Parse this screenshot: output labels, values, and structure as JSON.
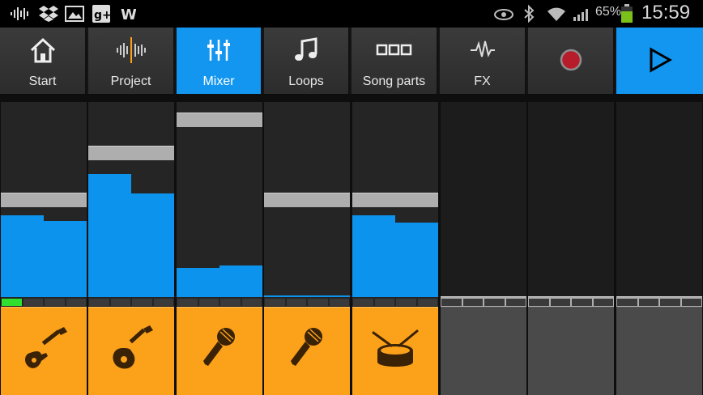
{
  "status_bar": {
    "icons": [
      "audio-wave-icon",
      "dropbox-icon",
      "gallery-icon",
      "google-plus-icon",
      "wordpress-icon",
      "eye-icon",
      "bluetooth-icon",
      "wifi-icon",
      "signal-icon",
      "battery-icon"
    ],
    "battery_percent": "65%",
    "time": "15:59"
  },
  "toolbar": {
    "tabs": [
      {
        "label": "Start",
        "icon": "home-icon",
        "active": false
      },
      {
        "label": "Project",
        "icon": "waveform-icon",
        "active": false
      },
      {
        "label": "Mixer",
        "icon": "sliders-icon",
        "active": true
      },
      {
        "label": "Loops",
        "icon": "music-note-icon",
        "active": false
      },
      {
        "label": "Song parts",
        "icon": "song-parts-icon",
        "active": false
      },
      {
        "label": "FX",
        "icon": "fx-wave-icon",
        "active": false
      }
    ],
    "record_icon": "record-icon",
    "play_icon": "play-icon",
    "colors": {
      "active": "#1296f0",
      "record": "#c62828",
      "accent": "#fca11a"
    }
  },
  "mixer": {
    "channels": [
      {
        "instrument": "electric-guitar-icon",
        "volume": 0.55,
        "meter_left": 0.42,
        "meter_right": 0.39,
        "active_step": 0,
        "empty": false
      },
      {
        "instrument": "acoustic-guitar-icon",
        "volume": 0.8,
        "meter_left": 0.63,
        "meter_right": 0.53,
        "empty": false
      },
      {
        "instrument": "microphone-icon",
        "volume": 0.98,
        "meter_left": 0.15,
        "meter_right": 0.16,
        "empty": false
      },
      {
        "instrument": "microphone-icon",
        "volume": 0.55,
        "meter_left": 0.005,
        "meter_right": 0.005,
        "empty": false
      },
      {
        "instrument": "drum-icon",
        "volume": 0.55,
        "meter_left": 0.42,
        "meter_right": 0.38,
        "empty": false
      },
      {
        "instrument": "",
        "volume": 0.0,
        "meter_left": 0,
        "meter_right": 0,
        "empty": true
      },
      {
        "instrument": "",
        "volume": 0.0,
        "meter_left": 0,
        "meter_right": 0,
        "empty": true
      },
      {
        "instrument": "",
        "volume": 0.0,
        "meter_left": 0,
        "meter_right": 0,
        "empty": true
      }
    ]
  }
}
